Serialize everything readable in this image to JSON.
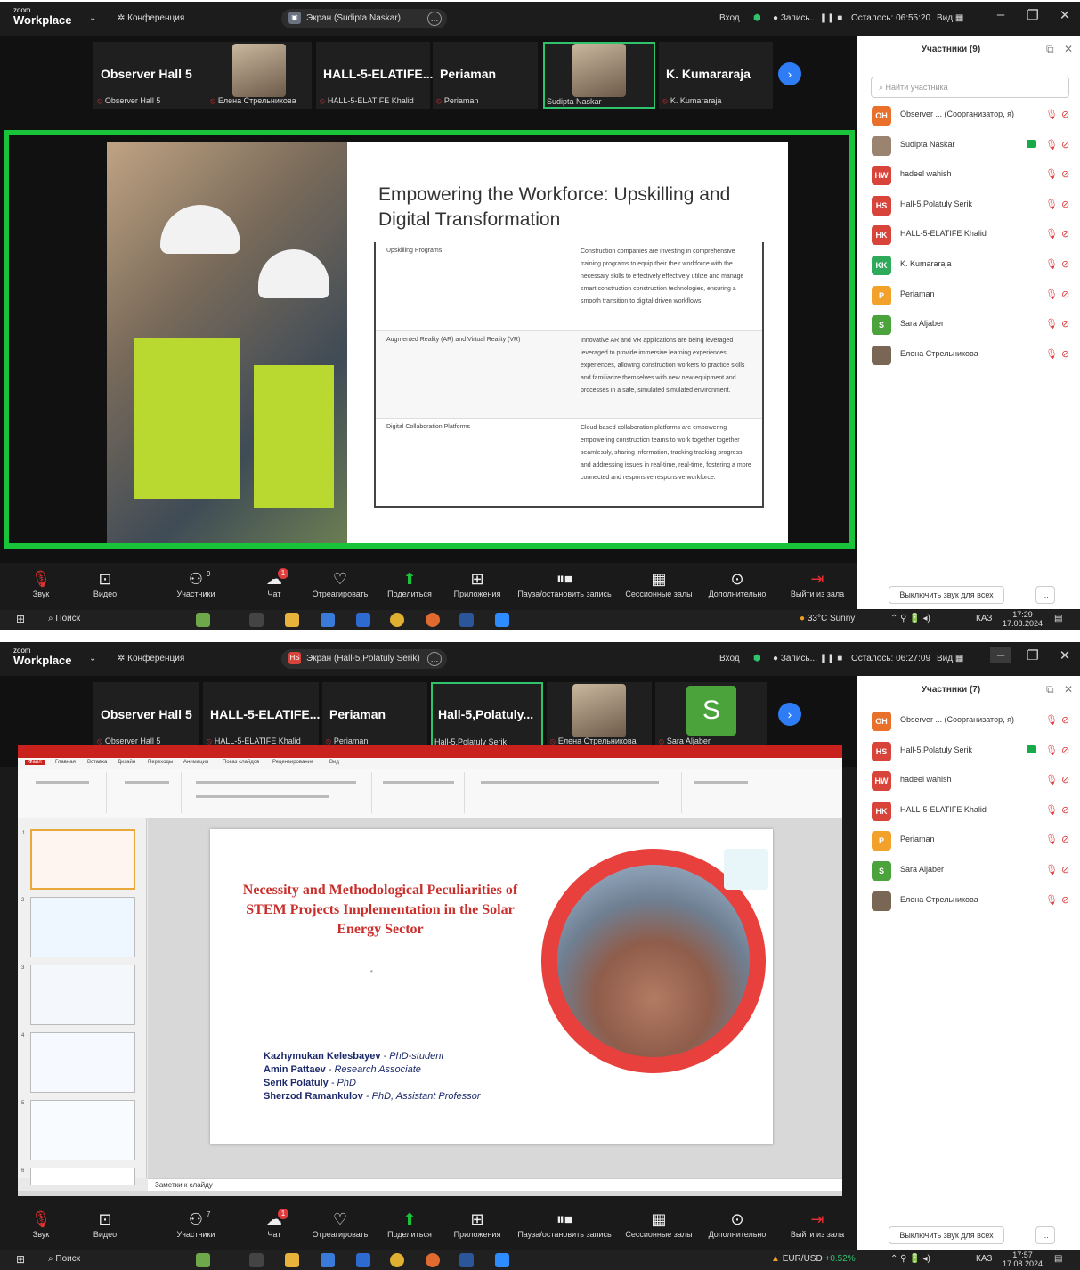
{
  "frame1": {
    "titlebar": {
      "logo_small": "zoom",
      "logo_big": "Workplace",
      "conference": "Конференция",
      "share_label": "Экран (Sudipta Naskar)",
      "login": "Вход",
      "record": "Запись...",
      "remaining": "Осталось: 06:55:20",
      "view": "Вид"
    },
    "strip": [
      {
        "name": "Observer Hall 5",
        "label": "Observer Hall 5"
      },
      {
        "name": "",
        "label": "Елена Стрельникова"
      },
      {
        "name": "HALL-5-ELATIFE...",
        "label": "HALL-5-ELATIFE Khalid"
      },
      {
        "name": "Periaman",
        "label": "Periaman"
      },
      {
        "name": "",
        "label": "Sudipta Naskar"
      },
      {
        "name": "K. Kumararaja",
        "label": "K. Kumararaja"
      }
    ],
    "slide": {
      "title": "Empowering the Workforce: Upskilling and Digital Transformation",
      "rows": [
        {
          "key": "Upskilling Programs",
          "value": "Construction companies are investing in comprehensive training programs to equip their their workforce with the necessary skills to effectively effectively utilize and manage smart construction construction technologies, ensuring a smooth transition to digital-driven workflows."
        },
        {
          "key": "Augmented Reality (AR) and Virtual Reality (VR)",
          "value": "Innovative AR and VR applications are being leveraged leveraged to provide immersive learning experiences, experiences, allowing construction workers to practice skills and familiarize themselves with new new equipment and processes in a safe, simulated simulated environment."
        },
        {
          "key": "Digital Collaboration Platforms",
          "value": "Cloud-based collaboration platforms are empowering empowering construction teams to work together together seamlessly, sharing information, tracking tracking progress, and addressing issues in real-time, real-time, fostering a more connected and responsive responsive workforce."
        }
      ]
    },
    "toolbar": {
      "audio": "Звук",
      "video": "Видео",
      "participants": "Участники",
      "participants_count": "9",
      "chat": "Чат",
      "chat_badge": "1",
      "react": "Отреагировать",
      "share": "Поделиться",
      "apps": "Приложения",
      "record": "Пауза/остановить запись",
      "rooms": "Сессионные залы",
      "more": "Дополнительно",
      "leave": "Выйти из зала"
    },
    "panel": {
      "title": "Участники (9)",
      "search_placeholder": "Найти участника",
      "mute_all": "Выключить звук для всех",
      "more": "...",
      "participants": [
        {
          "initials": "OH",
          "name": "Observer ... (Соорганизатор, я)",
          "color": "#e8702a"
        },
        {
          "initials": "",
          "name": "Sudipta Naskar",
          "color": "#9a8470"
        },
        {
          "initials": "HW",
          "name": "hadeel wahish",
          "color": "#d8443a"
        },
        {
          "initials": "HS",
          "name": "Hall-5,Polatuly Serik",
          "color": "#d8443a"
        },
        {
          "initials": "HK",
          "name": "HALL-5-ELATIFE Khalid",
          "color": "#d8443a"
        },
        {
          "initials": "KK",
          "name": "K. Kumararaja",
          "color": "#2eaa5a"
        },
        {
          "initials": "P",
          "name": "Periaman",
          "color": "#f2a22a"
        },
        {
          "initials": "S",
          "name": "Sara Aljaber",
          "color": "#4aa33b"
        },
        {
          "initials": "",
          "name": "Елена Стрельникова",
          "color": "#7a6655"
        }
      ]
    },
    "taskbar": {
      "search": "Поиск",
      "weather": "33°C  Sunny",
      "lang": "КАЗ",
      "time": "17:29",
      "date": "17.08.2024"
    }
  },
  "frame2": {
    "titlebar": {
      "logo_small": "zoom",
      "logo_big": "Workplace",
      "conference": "Конференция",
      "share_label": "Экран (Hall-5,Polatuly Serik)",
      "login": "Вход",
      "record": "Запись...",
      "remaining": "Осталось: 06:27:09",
      "view": "Вид"
    },
    "strip": [
      {
        "name": "Observer Hall 5",
        "label": "Observer Hall 5"
      },
      {
        "name": "HALL-5-ELATIFE...",
        "label": "HALL-5-ELATIFE Khalid"
      },
      {
        "name": "Periaman",
        "label": "Periaman"
      },
      {
        "name": "Hall-5,Polatuly...",
        "label": "Hall-5,Polatuly Serik"
      },
      {
        "name": "",
        "label": "Елена Стрельникова"
      },
      {
        "name": "",
        "label": "Sara Aljaber",
        "initial": "S"
      }
    ],
    "ppt": {
      "tabs": [
        "Файл",
        "Главная",
        "Вставка",
        "Дизайн",
        "Переходы",
        "Анимация",
        "Показ слайдов",
        "Рецензирование",
        "Вид"
      ],
      "slide_title": "Necessity and Methodological Peculiarities of STEM Projects Implementation in the Solar Energy Sector",
      "dot": "•",
      "authors": [
        {
          "name": "Kazhymukan Kelesbayev",
          "role": " - PhD-student"
        },
        {
          "name": "Amin Pattaev",
          "role": " - Research Associate"
        },
        {
          "name": "Serik Polatuly",
          "role": " - PhD"
        },
        {
          "name": "Sherzod Ramankulov",
          "role": " - PhD, Assistant Professor"
        }
      ],
      "notes": "Заметки к слайду",
      "thumb_numbers": [
        "1",
        "2",
        "3",
        "4",
        "5",
        "6"
      ]
    },
    "toolbar": {
      "audio": "Звук",
      "video": "Видео",
      "participants": "Участники",
      "participants_count": "7",
      "chat": "Чат",
      "chat_badge": "1",
      "react": "Отреагировать",
      "share": "Поделиться",
      "apps": "Приложения",
      "record": "Пауза/остановить запись",
      "rooms": "Сессионные залы",
      "more": "Дополнительно",
      "leave": "Выйти из зала"
    },
    "panel": {
      "title": "Участники (7)",
      "mute_all": "Выключить звук для всех",
      "more": "...",
      "participants": [
        {
          "initials": "OH",
          "name": "Observer ... (Соорганизатор, я)",
          "color": "#e8702a"
        },
        {
          "initials": "HS",
          "name": "Hall-5,Polatuly Serik",
          "color": "#d8443a"
        },
        {
          "initials": "HW",
          "name": "hadeel wahish",
          "color": "#d8443a"
        },
        {
          "initials": "HK",
          "name": "HALL-5-ELATIFE Khalid",
          "color": "#d8443a"
        },
        {
          "initials": "P",
          "name": "Periaman",
          "color": "#f2a22a"
        },
        {
          "initials": "S",
          "name": "Sara Aljaber",
          "color": "#4aa33b"
        },
        {
          "initials": "",
          "name": "Елена Стрельникова",
          "color": "#7a6655"
        }
      ]
    },
    "taskbar": {
      "search": "Поиск",
      "ticker": "EUR/USD",
      "ticker_change": "+0.52%",
      "lang": "КАЗ",
      "time": "17:57",
      "date": "17.08.2024"
    }
  },
  "colors": {
    "accent_green": "#19c43a",
    "share_blue": "#2e7cf6",
    "mute_red": "#d94040",
    "ppt_red": "#c9211e"
  }
}
